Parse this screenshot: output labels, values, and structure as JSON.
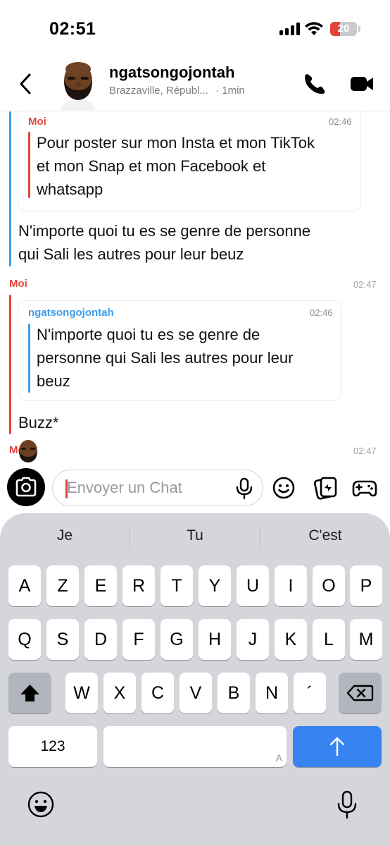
{
  "status_bar": {
    "time": "02:51",
    "battery": "20"
  },
  "header": {
    "contact_name": "ngatsongojontah",
    "location": "Brazzaville, Républ...",
    "last_seen": "· 1min"
  },
  "messages": [
    {
      "quote": {
        "sender": "Moi",
        "time": "02:46",
        "lines": [
          "Pour poster sur mon Insta et mon TikTok",
          "et mon Snap et mon Facebook et",
          "whatsapp"
        ]
      },
      "text_lines": [
        "N'importe quoi tu es se genre de personne",
        "qui Sali les autres pour leur beuz"
      ]
    },
    {
      "sender": "Moi",
      "time": "02:47",
      "quote": {
        "sender": "ngatsongojontah",
        "time": "02:46",
        "lines": [
          "N'importe quoi tu es se genre de",
          "personne qui Sali les autres pour leur",
          "beuz"
        ]
      },
      "text_lines": [
        "Buzz*"
      ]
    },
    {
      "sender": "Moi",
      "time": "02:47"
    }
  ],
  "input": {
    "placeholder": "Envoyer un Chat"
  },
  "keyboard": {
    "suggestions": [
      "Je",
      "Tu",
      "C'est"
    ],
    "row1": [
      "A",
      "Z",
      "E",
      "R",
      "T",
      "Y",
      "U",
      "I",
      "O",
      "P"
    ],
    "row2": [
      "Q",
      "S",
      "D",
      "F",
      "G",
      "H",
      "J",
      "K",
      "L",
      "M"
    ],
    "row3": [
      "W",
      "X",
      "C",
      "V",
      "B",
      "N",
      "´"
    ],
    "numbers_label": "123",
    "space_label": "A"
  },
  "colors": {
    "moi": "#e5443b",
    "contact": "#3e9ce8",
    "send": "#3883f2"
  },
  "icons": [
    "back-chevron-icon",
    "phone-icon",
    "video-icon",
    "camera-icon",
    "microphone-icon",
    "emoji-icon",
    "sticker-icon",
    "game-controller-icon",
    "shift-icon",
    "backspace-icon",
    "send-arrow-icon"
  ]
}
